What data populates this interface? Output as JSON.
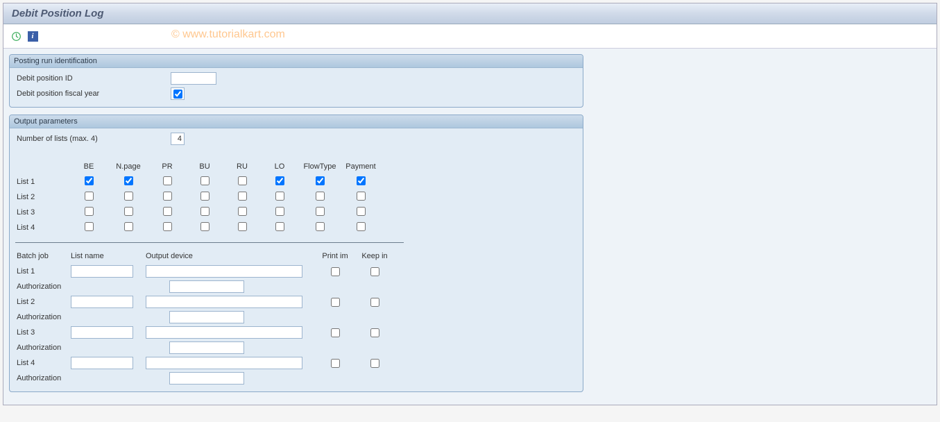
{
  "title": "Debit Position Log",
  "watermark": "© www.tutorialkart.com",
  "group1": {
    "header": "Posting run identification",
    "fields": {
      "debit_id_label": "Debit position ID",
      "debit_id_value": "",
      "fiscal_year_label": "Debit position fiscal year",
      "fiscal_year_checked": true
    }
  },
  "group2": {
    "header": "Output parameters",
    "num_lists_label": "Number of lists (max. 4)",
    "num_lists_value": "4",
    "cols": {
      "be": "BE",
      "npage": "N.page",
      "pr": "PR",
      "bu": "BU",
      "ru": "RU",
      "lo": "LO",
      "flow": "FlowType",
      "pay": "Payment"
    },
    "rows": [
      {
        "label": "List 1",
        "be": true,
        "npage": true,
        "pr": false,
        "bu": false,
        "ru": false,
        "lo": true,
        "flow": true,
        "pay": true
      },
      {
        "label": "List 2",
        "be": false,
        "npage": false,
        "pr": false,
        "bu": false,
        "ru": false,
        "lo": false,
        "flow": false,
        "pay": false
      },
      {
        "label": "List 3",
        "be": false,
        "npage": false,
        "pr": false,
        "bu": false,
        "ru": false,
        "lo": false,
        "flow": false,
        "pay": false
      },
      {
        "label": "List 4",
        "be": false,
        "npage": false,
        "pr": false,
        "bu": false,
        "ru": false,
        "lo": false,
        "flow": false,
        "pay": false
      }
    ],
    "batch": {
      "headers": {
        "batch": "Batch job",
        "listname": "List name",
        "outdev": "Output device",
        "printim": "Print im",
        "keepin": "Keep in"
      },
      "auth_label": "Authorization",
      "rows": [
        {
          "label": "List 1",
          "listname": "",
          "outdev": "",
          "printim": false,
          "keepin": false,
          "auth": ""
        },
        {
          "label": "List 2",
          "listname": "",
          "outdev": "",
          "printim": false,
          "keepin": false,
          "auth": ""
        },
        {
          "label": "List 3",
          "listname": "",
          "outdev": "",
          "printim": false,
          "keepin": false,
          "auth": ""
        },
        {
          "label": "List 4",
          "listname": "",
          "outdev": "",
          "printim": false,
          "keepin": false,
          "auth": ""
        }
      ]
    }
  }
}
